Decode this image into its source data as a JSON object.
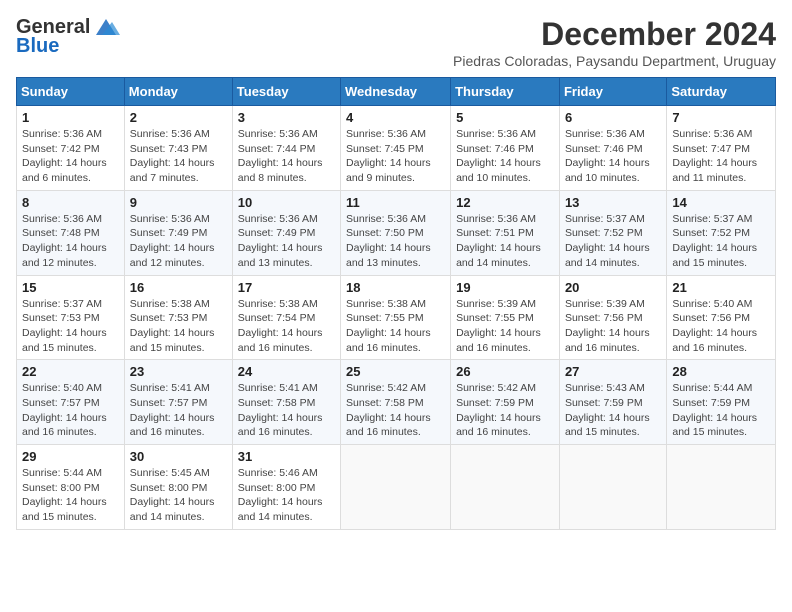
{
  "header": {
    "logo_general": "General",
    "logo_blue": "Blue",
    "month_title": "December 2024",
    "subtitle": "Piedras Coloradas, Paysandu Department, Uruguay"
  },
  "days_of_week": [
    "Sunday",
    "Monday",
    "Tuesday",
    "Wednesday",
    "Thursday",
    "Friday",
    "Saturday"
  ],
  "weeks": [
    [
      {
        "day": "1",
        "sunrise": "5:36 AM",
        "sunset": "7:42 PM",
        "daylight": "14 hours and 6 minutes."
      },
      {
        "day": "2",
        "sunrise": "5:36 AM",
        "sunset": "7:43 PM",
        "daylight": "14 hours and 7 minutes."
      },
      {
        "day": "3",
        "sunrise": "5:36 AM",
        "sunset": "7:44 PM",
        "daylight": "14 hours and 8 minutes."
      },
      {
        "day": "4",
        "sunrise": "5:36 AM",
        "sunset": "7:45 PM",
        "daylight": "14 hours and 9 minutes."
      },
      {
        "day": "5",
        "sunrise": "5:36 AM",
        "sunset": "7:46 PM",
        "daylight": "14 hours and 10 minutes."
      },
      {
        "day": "6",
        "sunrise": "5:36 AM",
        "sunset": "7:46 PM",
        "daylight": "14 hours and 10 minutes."
      },
      {
        "day": "7",
        "sunrise": "5:36 AM",
        "sunset": "7:47 PM",
        "daylight": "14 hours and 11 minutes."
      }
    ],
    [
      {
        "day": "8",
        "sunrise": "5:36 AM",
        "sunset": "7:48 PM",
        "daylight": "14 hours and 12 minutes."
      },
      {
        "day": "9",
        "sunrise": "5:36 AM",
        "sunset": "7:49 PM",
        "daylight": "14 hours and 12 minutes."
      },
      {
        "day": "10",
        "sunrise": "5:36 AM",
        "sunset": "7:49 PM",
        "daylight": "14 hours and 13 minutes."
      },
      {
        "day": "11",
        "sunrise": "5:36 AM",
        "sunset": "7:50 PM",
        "daylight": "14 hours and 13 minutes."
      },
      {
        "day": "12",
        "sunrise": "5:36 AM",
        "sunset": "7:51 PM",
        "daylight": "14 hours and 14 minutes."
      },
      {
        "day": "13",
        "sunrise": "5:37 AM",
        "sunset": "7:52 PM",
        "daylight": "14 hours and 14 minutes."
      },
      {
        "day": "14",
        "sunrise": "5:37 AM",
        "sunset": "7:52 PM",
        "daylight": "14 hours and 15 minutes."
      }
    ],
    [
      {
        "day": "15",
        "sunrise": "5:37 AM",
        "sunset": "7:53 PM",
        "daylight": "14 hours and 15 minutes."
      },
      {
        "day": "16",
        "sunrise": "5:38 AM",
        "sunset": "7:53 PM",
        "daylight": "14 hours and 15 minutes."
      },
      {
        "day": "17",
        "sunrise": "5:38 AM",
        "sunset": "7:54 PM",
        "daylight": "14 hours and 16 minutes."
      },
      {
        "day": "18",
        "sunrise": "5:38 AM",
        "sunset": "7:55 PM",
        "daylight": "14 hours and 16 minutes."
      },
      {
        "day": "19",
        "sunrise": "5:39 AM",
        "sunset": "7:55 PM",
        "daylight": "14 hours and 16 minutes."
      },
      {
        "day": "20",
        "sunrise": "5:39 AM",
        "sunset": "7:56 PM",
        "daylight": "14 hours and 16 minutes."
      },
      {
        "day": "21",
        "sunrise": "5:40 AM",
        "sunset": "7:56 PM",
        "daylight": "14 hours and 16 minutes."
      }
    ],
    [
      {
        "day": "22",
        "sunrise": "5:40 AM",
        "sunset": "7:57 PM",
        "daylight": "14 hours and 16 minutes."
      },
      {
        "day": "23",
        "sunrise": "5:41 AM",
        "sunset": "7:57 PM",
        "daylight": "14 hours and 16 minutes."
      },
      {
        "day": "24",
        "sunrise": "5:41 AM",
        "sunset": "7:58 PM",
        "daylight": "14 hours and 16 minutes."
      },
      {
        "day": "25",
        "sunrise": "5:42 AM",
        "sunset": "7:58 PM",
        "daylight": "14 hours and 16 minutes."
      },
      {
        "day": "26",
        "sunrise": "5:42 AM",
        "sunset": "7:59 PM",
        "daylight": "14 hours and 16 minutes."
      },
      {
        "day": "27",
        "sunrise": "5:43 AM",
        "sunset": "7:59 PM",
        "daylight": "14 hours and 15 minutes."
      },
      {
        "day": "28",
        "sunrise": "5:44 AM",
        "sunset": "7:59 PM",
        "daylight": "14 hours and 15 minutes."
      }
    ],
    [
      {
        "day": "29",
        "sunrise": "5:44 AM",
        "sunset": "8:00 PM",
        "daylight": "14 hours and 15 minutes."
      },
      {
        "day": "30",
        "sunrise": "5:45 AM",
        "sunset": "8:00 PM",
        "daylight": "14 hours and 14 minutes."
      },
      {
        "day": "31",
        "sunrise": "5:46 AM",
        "sunset": "8:00 PM",
        "daylight": "14 hours and 14 minutes."
      },
      null,
      null,
      null,
      null
    ]
  ],
  "labels": {
    "sunrise": "Sunrise:",
    "sunset": "Sunset:",
    "daylight": "Daylight:"
  }
}
